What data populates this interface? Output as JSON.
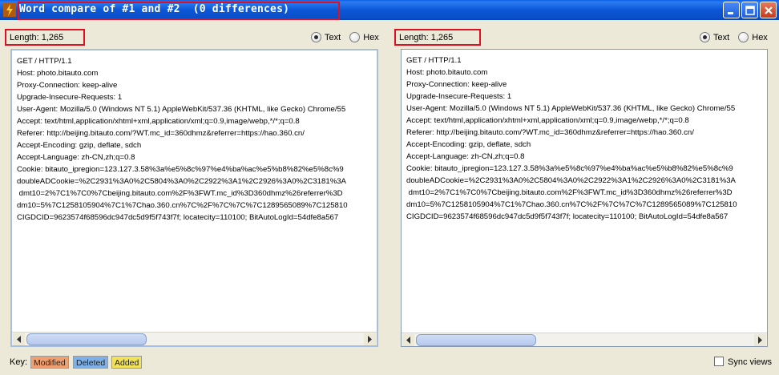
{
  "window": {
    "title": "Word compare of #1 and #2  (0 differences)"
  },
  "left_panel": {
    "length_label": "Length: 1,265",
    "radio_text": "Text",
    "radio_hex": "Hex",
    "selected": "Text",
    "lines": [
      "GET / HTTP/1.1",
      "Host: photo.bitauto.com",
      "Proxy-Connection: keep-alive",
      "Upgrade-Insecure-Requests: 1",
      "User-Agent: Mozilla/5.0 (Windows NT 5.1) AppleWebKit/537.36 (KHTML, like Gecko) Chrome/55",
      "Accept: text/html,application/xhtml+xml,application/xml;q=0.9,image/webp,*/*;q=0.8",
      "Referer: http://beijing.bitauto.com/?WT.mc_id=360dhmz&referrer=https://hao.360.cn/",
      "Accept-Encoding: gzip, deflate, sdch",
      "Accept-Language: zh-CN,zh;q=0.8",
      "Cookie: bitauto_ipregion=123.127.3.58%3a%e5%8c%97%e4%ba%ac%e5%b8%82%e5%8c%9",
      "doubleADCookie=%2C2931%3A0%2C5804%3A0%2C2922%3A1%2C2926%3A0%2C3181%3A",
      " dmt10=2%7C1%7C0%7Cbeijing.bitauto.com%2F%3FWT.mc_id%3D360dhmz%26referrer%3D",
      "dm10=5%7C1258105904%7C1%7Chao.360.cn%7C%2F%7C%7C%7C1289565089%7C125810",
      "CIGDCID=9623574f68596dc947dc5d9f5f743f7f; locatecity=110100; BitAutoLogId=54dfe8a567"
    ]
  },
  "right_panel": {
    "length_label": "Length: 1,265",
    "radio_text": "Text",
    "radio_hex": "Hex",
    "selected": "Text",
    "lines": [
      "GET / HTTP/1.1",
      "Host: photo.bitauto.com",
      "Proxy-Connection: keep-alive",
      "Upgrade-Insecure-Requests: 1",
      "User-Agent: Mozilla/5.0 (Windows NT 5.1) AppleWebKit/537.36 (KHTML, like Gecko) Chrome/55",
      "Accept: text/html,application/xhtml+xml,application/xml;q=0.9,image/webp,*/*;q=0.8",
      "Referer: http://beijing.bitauto.com/?WT.mc_id=360dhmz&referrer=https://hao.360.cn/",
      "Accept-Encoding: gzip, deflate, sdch",
      "Accept-Language: zh-CN,zh;q=0.8",
      "Cookie: bitauto_ipregion=123.127.3.58%3a%e5%8c%97%e4%ba%ac%e5%b8%82%e5%8c%9",
      "doubleADCookie=%2C2931%3A0%2C5804%3A0%2C2922%3A1%2C2926%3A0%2C3181%3A",
      " dmt10=2%7C1%7C0%7Cbeijing.bitauto.com%2F%3FWT.mc_id%3D360dhmz%26referrer%3D",
      "dm10=5%7C1258105904%7C1%7Chao.360.cn%7C%2F%7C%7C%7C1289565089%7C125810",
      "CIGDCID=9623574f68596dc947dc5d9f5f743f7f; locatecity=110100; BitAutoLogId=54dfe8a567"
    ]
  },
  "footer": {
    "key_label": "Key:",
    "tags": [
      {
        "label": "Modified",
        "color": "#f0a070"
      },
      {
        "label": "Deleted",
        "color": "#7fb0e6"
      },
      {
        "label": "Added",
        "color": "#f2e25a"
      }
    ],
    "sync_label": "Sync views",
    "sync_checked": false
  },
  "icons": {
    "app": "app-icon",
    "minimize": "minimize-icon",
    "maximize": "maximize-icon",
    "close": "close-icon"
  },
  "colors": {
    "titlebar": "#0a54d6",
    "highlight_box": "#e01020",
    "window_bg": "#ece9d8"
  }
}
